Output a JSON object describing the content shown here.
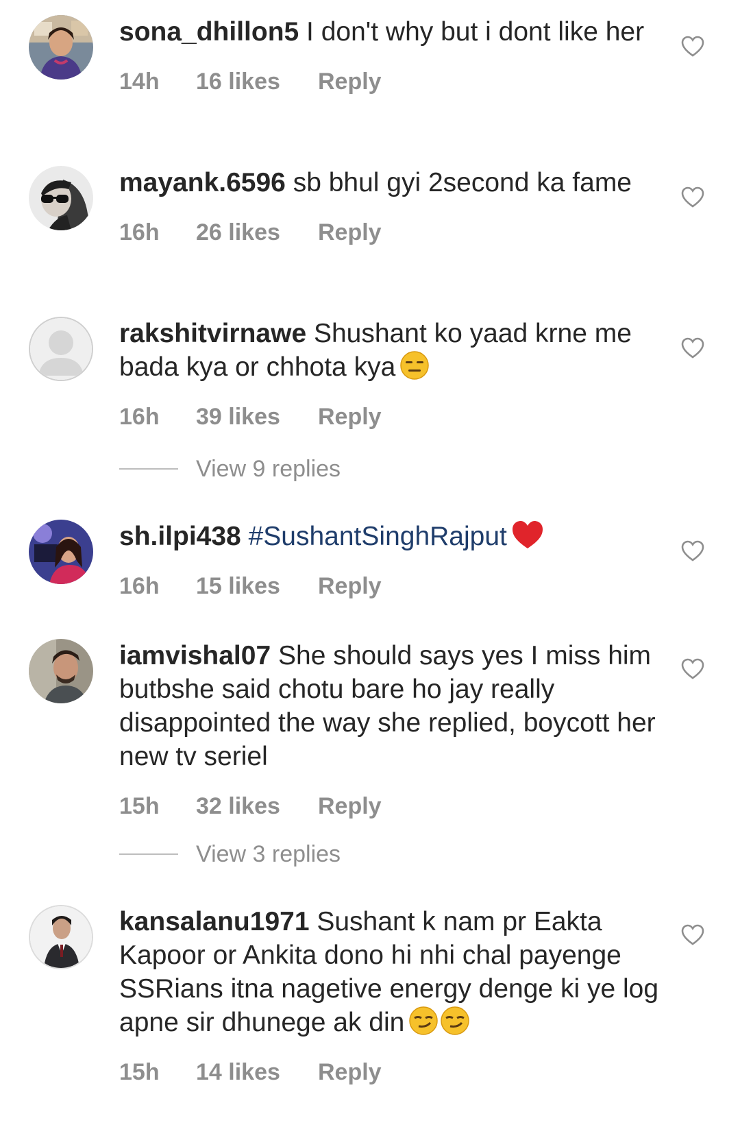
{
  "comments": [
    {
      "username": "sona_dhillon5",
      "text": "I don't why but i dont like her",
      "time": "14h",
      "likes": "16 likes",
      "reply": "Reply",
      "avatar": "photo"
    },
    {
      "username": "mayank.6596",
      "text": "sb bhul gyi 2second ka fame",
      "time": "16h",
      "likes": "26 likes",
      "reply": "Reply",
      "avatar": "photo"
    },
    {
      "username": "rakshitvirnawe",
      "text": "Shushant ko yaad krne me bada kya or chhota kya",
      "time": "16h",
      "likes": "39 likes",
      "reply": "Reply",
      "avatar": "default"
    },
    {
      "username": "sh.ilpi438",
      "text": "#SushantSinghRajput",
      "time": "16h",
      "likes": "15 likes",
      "reply": "Reply",
      "avatar": "photo"
    },
    {
      "username": "iamvishal07",
      "text": "She should says yes I miss him butbshe said chotu bare ho jay really disappointed the way she replied, boycott her new tv seriel",
      "time": "15h",
      "likes": "32 likes",
      "reply": "Reply",
      "avatar": "photo"
    },
    {
      "username": "kansalanu1971",
      "text": "Sushant k nam pr Eakta Kapoor or Ankita dono hi nhi chal payenge SSRians itna nagetive energy denge ki ye log apne sir dhunege ak din",
      "time": "15h",
      "likes": "14 likes",
      "reply": "Reply",
      "avatar": "photo"
    }
  ],
  "view_replies": [
    {
      "label": "View 9 replies"
    },
    {
      "label": "View 3 replies"
    }
  ],
  "emojis": {
    "comment3": "expressionless-face",
    "comment4": "red-heart",
    "comment6": [
      "smirking-face",
      "smirking-face"
    ]
  },
  "icons": {
    "like": "heart-outline-icon"
  },
  "colors": {
    "text": "#262626",
    "meta": "#8e8e8e",
    "hashtag": "#1f3d6b",
    "heart": "#e0242b"
  }
}
